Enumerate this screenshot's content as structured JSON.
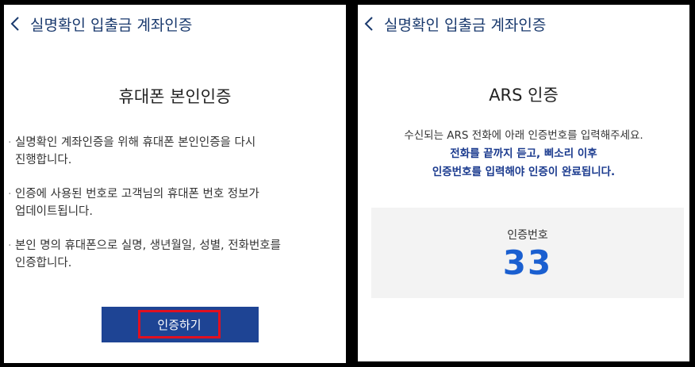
{
  "left_panel": {
    "header_title": "실명확인 입출금 계좌인증",
    "heading": "휴대폰 본인인증",
    "bullets": [
      "실명확인 계좌인증을 위해 휴대폰 본인인증을 다시\n진행합니다.",
      "인증에 사용된 번호로 고객님의 휴대폰 번호 정보가\n업데이트됩니다.",
      "본인 명의 휴대폰으로 실명, 생년월일, 성별, 전화번호를\n인증합니다."
    ],
    "bullet_marker": "·",
    "button_label": "인증하기"
  },
  "right_panel": {
    "header_title": "실명확인 입출금 계좌인증",
    "heading": "ARS 인증",
    "desc_line1": "수신되는 ARS 전화에 아래 인증번호를 입력해주세요.",
    "desc_line2": "전화를 끝까지 듣고, 삐소리 이후",
    "desc_line3": "인증번호를 입력해야 인증이 완료됩니다.",
    "code_label": "인증번호",
    "code_value": "33"
  },
  "icons": {
    "back": "chevron-left-icon"
  },
  "colors": {
    "accent": "#1e4494",
    "highlight": "#e01020",
    "code": "#1a5fd0"
  }
}
